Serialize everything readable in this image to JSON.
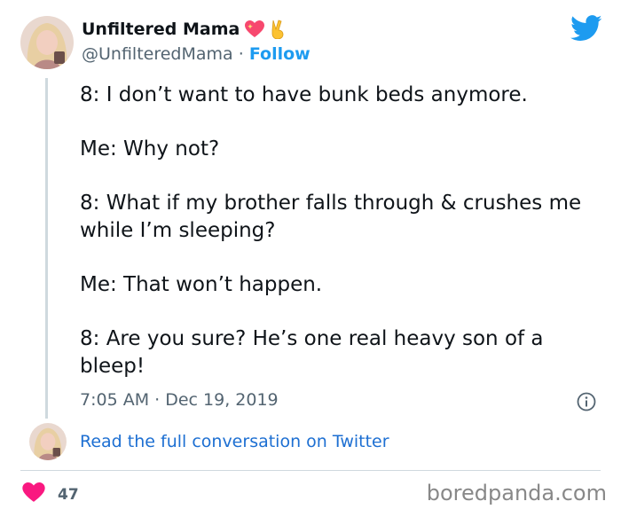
{
  "author": {
    "name": "Unfiltered Mama",
    "handle": "@UnfilteredMama",
    "separator": "·",
    "follow_label": "Follow",
    "name_emojis": [
      "sparkling-heart",
      "victory-hand"
    ]
  },
  "tweet": {
    "lines": [
      "8: I don’t want to have bunk beds anymore.",
      "Me: Why not?",
      "8: What if my brother falls through & crushes me while I’m sleeping?",
      "Me: That won’t happen.",
      "8: Are you sure? He’s one real heavy son of a bleep!"
    ],
    "timestamp": "7:05 AM · Dec 19, 2019"
  },
  "footer": {
    "read_conversation": "Read the full conversation on Twitter",
    "likes": "47"
  },
  "watermark": "boredpanda.com",
  "colors": {
    "accent": "#1d9bf0",
    "link": "#1d6fd2",
    "heart": "#f91880",
    "muted": "#536471",
    "text": "#0f1419"
  },
  "icons": [
    "twitter-bird-icon",
    "info-icon",
    "heart-icon"
  ]
}
